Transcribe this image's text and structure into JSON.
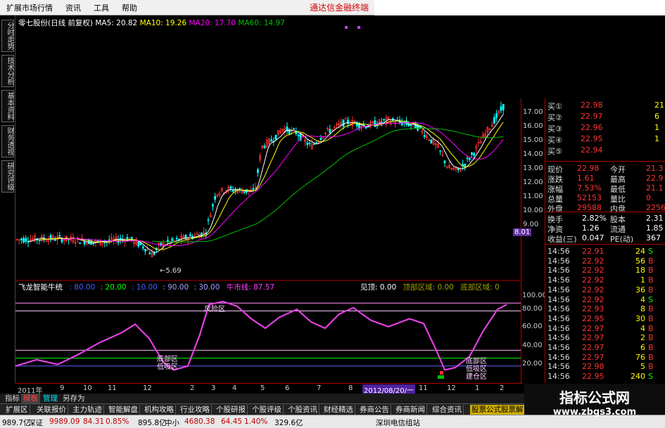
{
  "menu": {
    "items": [
      "扩展市场行情",
      "资讯",
      "工具",
      "帮助"
    ],
    "brand": "通达信金融终端"
  },
  "left_tabs": [
    "分时走势",
    "技术分析",
    "基本资料",
    "财务透视",
    "研究评级"
  ],
  "chart_legend": {
    "stock": "零七股份(日线 前复权)",
    "ma5": "MA5: 20.82",
    "ma10": "MA10: 19.26",
    "ma20": "MA20: 17.70",
    "ma60": "MA60: 14.97",
    "low_label": "5.69"
  },
  "indicator": {
    "name": "飞龙智能牛统",
    "v1": ": 80.00",
    "v2": ": 20.00",
    "v3": ": 10.00",
    "v4": ": 90.00",
    "v5": ": 30.00",
    "bull_line": "牛市线: 87.57",
    "top": "见顶: 0.00",
    "top_zone": "顶部区域: 0.00",
    "bottom_zone": "底部区域: 0",
    "zone_high": "风险区",
    "zone_low1": "底部区",
    "zone_low2": "低吸区",
    "zone_low3": "底部区",
    "zone_low4": "低吸区",
    "zone_low5": "建仓区",
    "y_ticks": [
      "100.00",
      "80.00",
      "60.00",
      "40.00",
      "20.00"
    ]
  },
  "price_axis": [
    "17.00",
    "16.00",
    "15.00",
    "14.00",
    "13.00",
    "12.00",
    "11.00",
    "10.00",
    "9.00",
    "8.01"
  ],
  "quote": {
    "bids": [
      {
        "label": "买①",
        "price": "22.98",
        "vol": "21"
      },
      {
        "label": "买②",
        "price": "22.97",
        "vol": "6"
      },
      {
        "label": "买③",
        "price": "22.96",
        "vol": "1"
      },
      {
        "label": "买④",
        "price": "22.95",
        "vol": "1"
      },
      {
        "label": "买⑤",
        "price": "22.94",
        "vol": ""
      }
    ],
    "stats": [
      {
        "l1": "现价",
        "v1": "22.98",
        "l2": "今开",
        "v2": "21.3"
      },
      {
        "l1": "涨跌",
        "v1": "1.61",
        "l2": "最高",
        "v2": "22.9"
      },
      {
        "l1": "涨幅",
        "v1": "7.53%",
        "l2": "最低",
        "v2": "21.1"
      },
      {
        "l1": "总量",
        "v1": "52153",
        "l2": "量比",
        "v2": "0."
      },
      {
        "l1": "外盘",
        "v1": "29588",
        "l2": "内盘",
        "v2": "2256"
      }
    ],
    "stats2": [
      {
        "l1": "换手",
        "v1": "2.82%",
        "l2": "股本",
        "v2": "2.31"
      },
      {
        "l1": "净资",
        "v1": "1.26",
        "l2": "流通",
        "v2": "1.85"
      },
      {
        "l1": "收益(三)",
        "v1": "0.047",
        "l2": "PE(动)",
        "v2": "367"
      }
    ],
    "ticks": [
      {
        "t": "14:56",
        "p": "22.91",
        "v": "24",
        "d": "S"
      },
      {
        "t": "14:56",
        "p": "22.92",
        "v": "56",
        "d": "B"
      },
      {
        "t": "14:56",
        "p": "22.92",
        "v": "18",
        "d": "B"
      },
      {
        "t": "14:56",
        "p": "22.92",
        "v": "1",
        "d": "B"
      },
      {
        "t": "14:56",
        "p": "22.92",
        "v": "36",
        "d": "B"
      },
      {
        "t": "14:56",
        "p": "22.92",
        "v": "4",
        "d": "S"
      },
      {
        "t": "14:56",
        "p": "22.93",
        "v": "8",
        "d": "B"
      },
      {
        "t": "14:56",
        "p": "22.95",
        "v": "30",
        "d": "B"
      },
      {
        "t": "14:56",
        "p": "22.97",
        "v": "4",
        "d": "B"
      },
      {
        "t": "14:56",
        "p": "22.97",
        "v": "2",
        "d": "B"
      },
      {
        "t": "14:56",
        "p": "22.97",
        "v": "6",
        "d": "B"
      },
      {
        "t": "14:56",
        "p": "22.97",
        "v": "76",
        "d": "B"
      },
      {
        "t": "14:56",
        "p": "22.98",
        "v": "5",
        "d": "B"
      },
      {
        "t": "14:56",
        "p": "22.95",
        "v": "240",
        "d": "S"
      }
    ]
  },
  "time_axis": [
    "2011年",
    "9",
    "10",
    "11",
    "12",
    "2",
    "3",
    "4",
    "5",
    "6",
    "7",
    "8",
    "2012/08/20/一",
    "11",
    "12",
    "1",
    "2"
  ],
  "sheet_tabs": [
    "指标",
    "模板",
    "管理",
    "另存为"
  ],
  "func_tabs": [
    "扩展区",
    "关联报价",
    "主力轨迹",
    "智能解盘",
    "机构攻略",
    "行业攻略",
    "个股研报",
    "个股评级",
    "个股资讯",
    "财经精选",
    "券商公告",
    "券商新闻",
    "综合资讯",
    "股票公式股票解"
  ],
  "status": {
    "s1": "989.7亿",
    "s2": "深证",
    "s3": "9989.09",
    "s4": "84.31",
    "s5": "0.85%",
    "s6": "895.8亿",
    "s7": "中小",
    "s8": "4680.38",
    "s9": "64.45",
    "s10": "1.40%",
    "s11": "329.6亿",
    "s12": "深圳电信组站"
  },
  "watermark": {
    "title": "指标公式网",
    "url": "www.zbgs3.com"
  },
  "colors": {
    "up": "#ff3232",
    "down": "#00ffff",
    "ma5": "#ffffff",
    "ma10": "#ffff00",
    "ma20": "#ff00ff",
    "ma60": "#00c000",
    "oscillator": "#e040e0",
    "bg": "#000000"
  }
}
